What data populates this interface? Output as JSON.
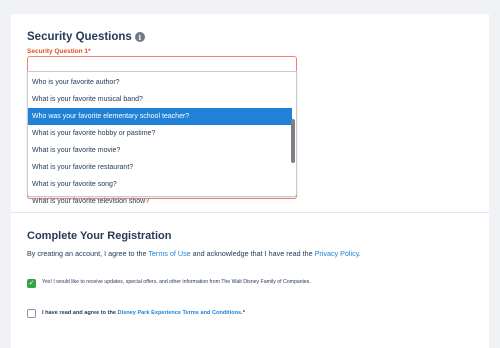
{
  "security": {
    "title": "Security Questions",
    "info_icon_glyph": "i",
    "field_label": "Security Question 1",
    "required_mark": "*",
    "options": [
      "Who is your favorite author?",
      "What is your favorite musical band?",
      "Who was your favorite elementary school teacher?",
      "What is your favorite hobby or pastime?",
      "What is your favorite movie?",
      "What is your favorite restaurant?",
      "What is your favorite song?",
      "What is your favorite television show?"
    ],
    "selected_index": 2
  },
  "registration": {
    "title": "Complete Your Registration",
    "agree_prefix": "By creating an account, I agree to the ",
    "terms_link": "Terms of Use",
    "agree_middle": " and acknowledge that I have read the ",
    "privacy_link": "Privacy Policy",
    "agree_suffix": ".",
    "optin_text": "Yes! I would like to receive updates, special offers, and other information from The Walt Disney Family of Companies.",
    "optin_checked": true,
    "terms_prefix": "I have read and agree to the ",
    "terms_link_text": "Disney Park Experience Terms and Conditions.",
    "terms_required_mark": "*",
    "terms_checked": false,
    "check_glyph": "✓"
  },
  "colors": {
    "accent_blue": "#1f82d6",
    "error_orange": "#e0502b",
    "check_green": "#3aa14b",
    "text_navy": "#253b56"
  },
  "icons": {
    "info": "info-icon",
    "checkbox_checked": "checkbox-checked-icon",
    "checkbox_unchecked": "checkbox-empty-icon"
  }
}
